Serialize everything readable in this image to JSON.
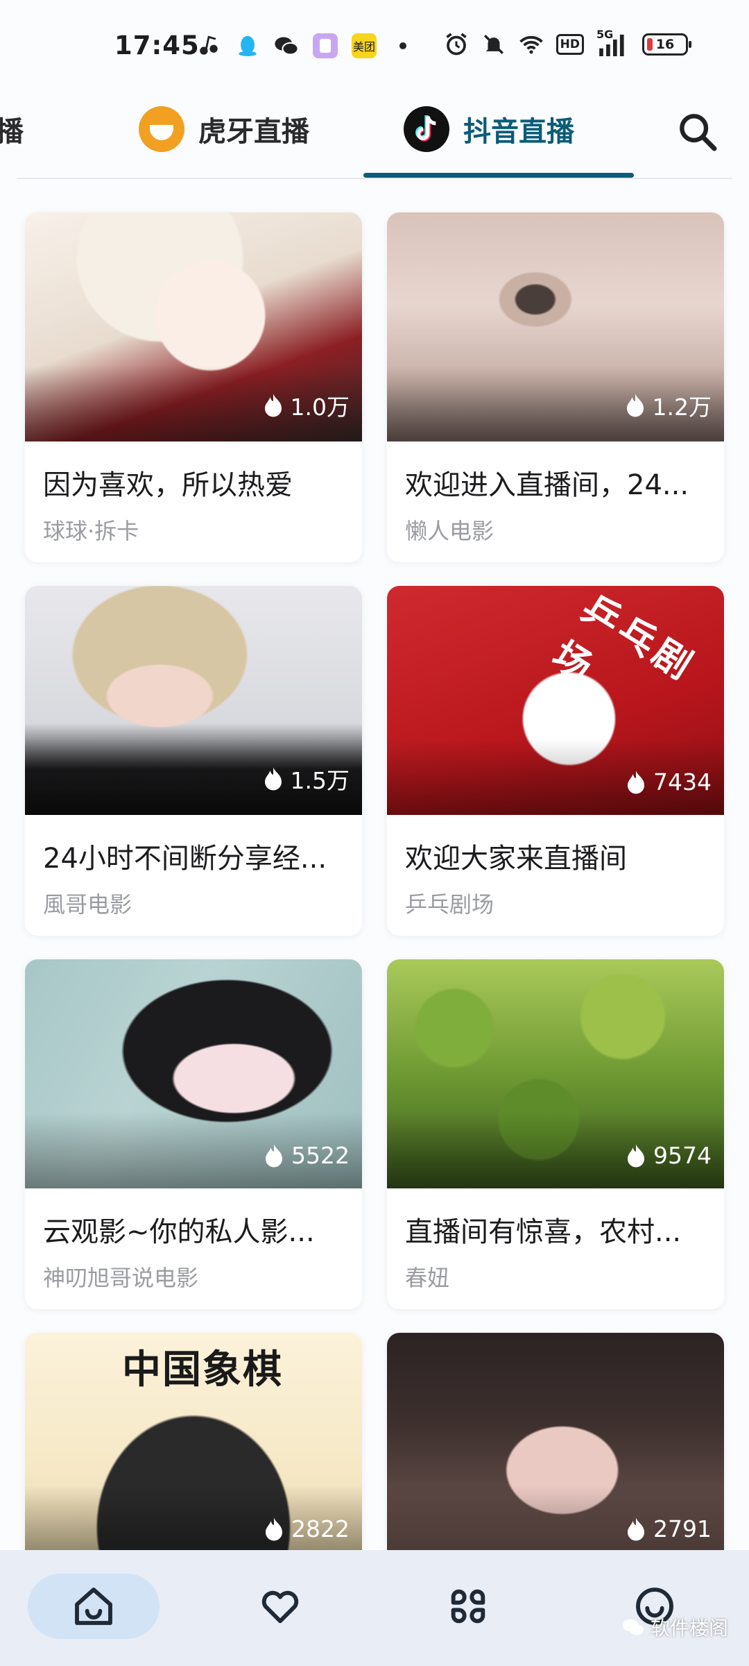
{
  "status_bar": {
    "time": "17:45",
    "app_icons": [
      "music-icon",
      "qq-icon",
      "wechat-icon",
      "notes-icon",
      "meituan-icon"
    ],
    "meituan_label": "美团",
    "system_icons": [
      "alarm-icon",
      "mute-icon",
      "wifi-icon",
      "hd-icon",
      "signal-5g-icon",
      "battery-icon"
    ],
    "hd_label": "HD",
    "net_label": "5G",
    "battery": "16"
  },
  "tabs": {
    "partial_label": "播",
    "huya_label": "虎牙直播",
    "douyin_label": "抖音直播",
    "active": "抖音直播",
    "accent": "#0b5c78"
  },
  "cards": [
    {
      "title": "因为喜欢，所以热爱",
      "author": "球球·拆卡",
      "heat": "1.0万"
    },
    {
      "title": "欢迎进入直播间，24...",
      "author": "懒人电影",
      "heat": "1.2万"
    },
    {
      "title": "24小时不间断分享经...",
      "author": "風哥电影",
      "heat": "1.5万"
    },
    {
      "title": "欢迎大家来直播间",
      "author": "乒乓剧场",
      "heat": "7434",
      "thumb_text": "乒乓剧场"
    },
    {
      "title": "云观影~你的私人影...",
      "author": "神叨旭哥说电影",
      "heat": "5522"
    },
    {
      "title": "直播间有惊喜，农村...",
      "author": "春妞",
      "heat": "9574"
    },
    {
      "title": "",
      "author": "",
      "heat": "2822",
      "thumb_text": "中国象棋"
    },
    {
      "title": "",
      "author": "",
      "heat": "2791"
    }
  ],
  "bottom_nav": {
    "items": [
      "home-icon",
      "favorites-icon",
      "apps-icon",
      "profile-icon"
    ],
    "active": "home-icon"
  },
  "watermark": "软件楼阁"
}
